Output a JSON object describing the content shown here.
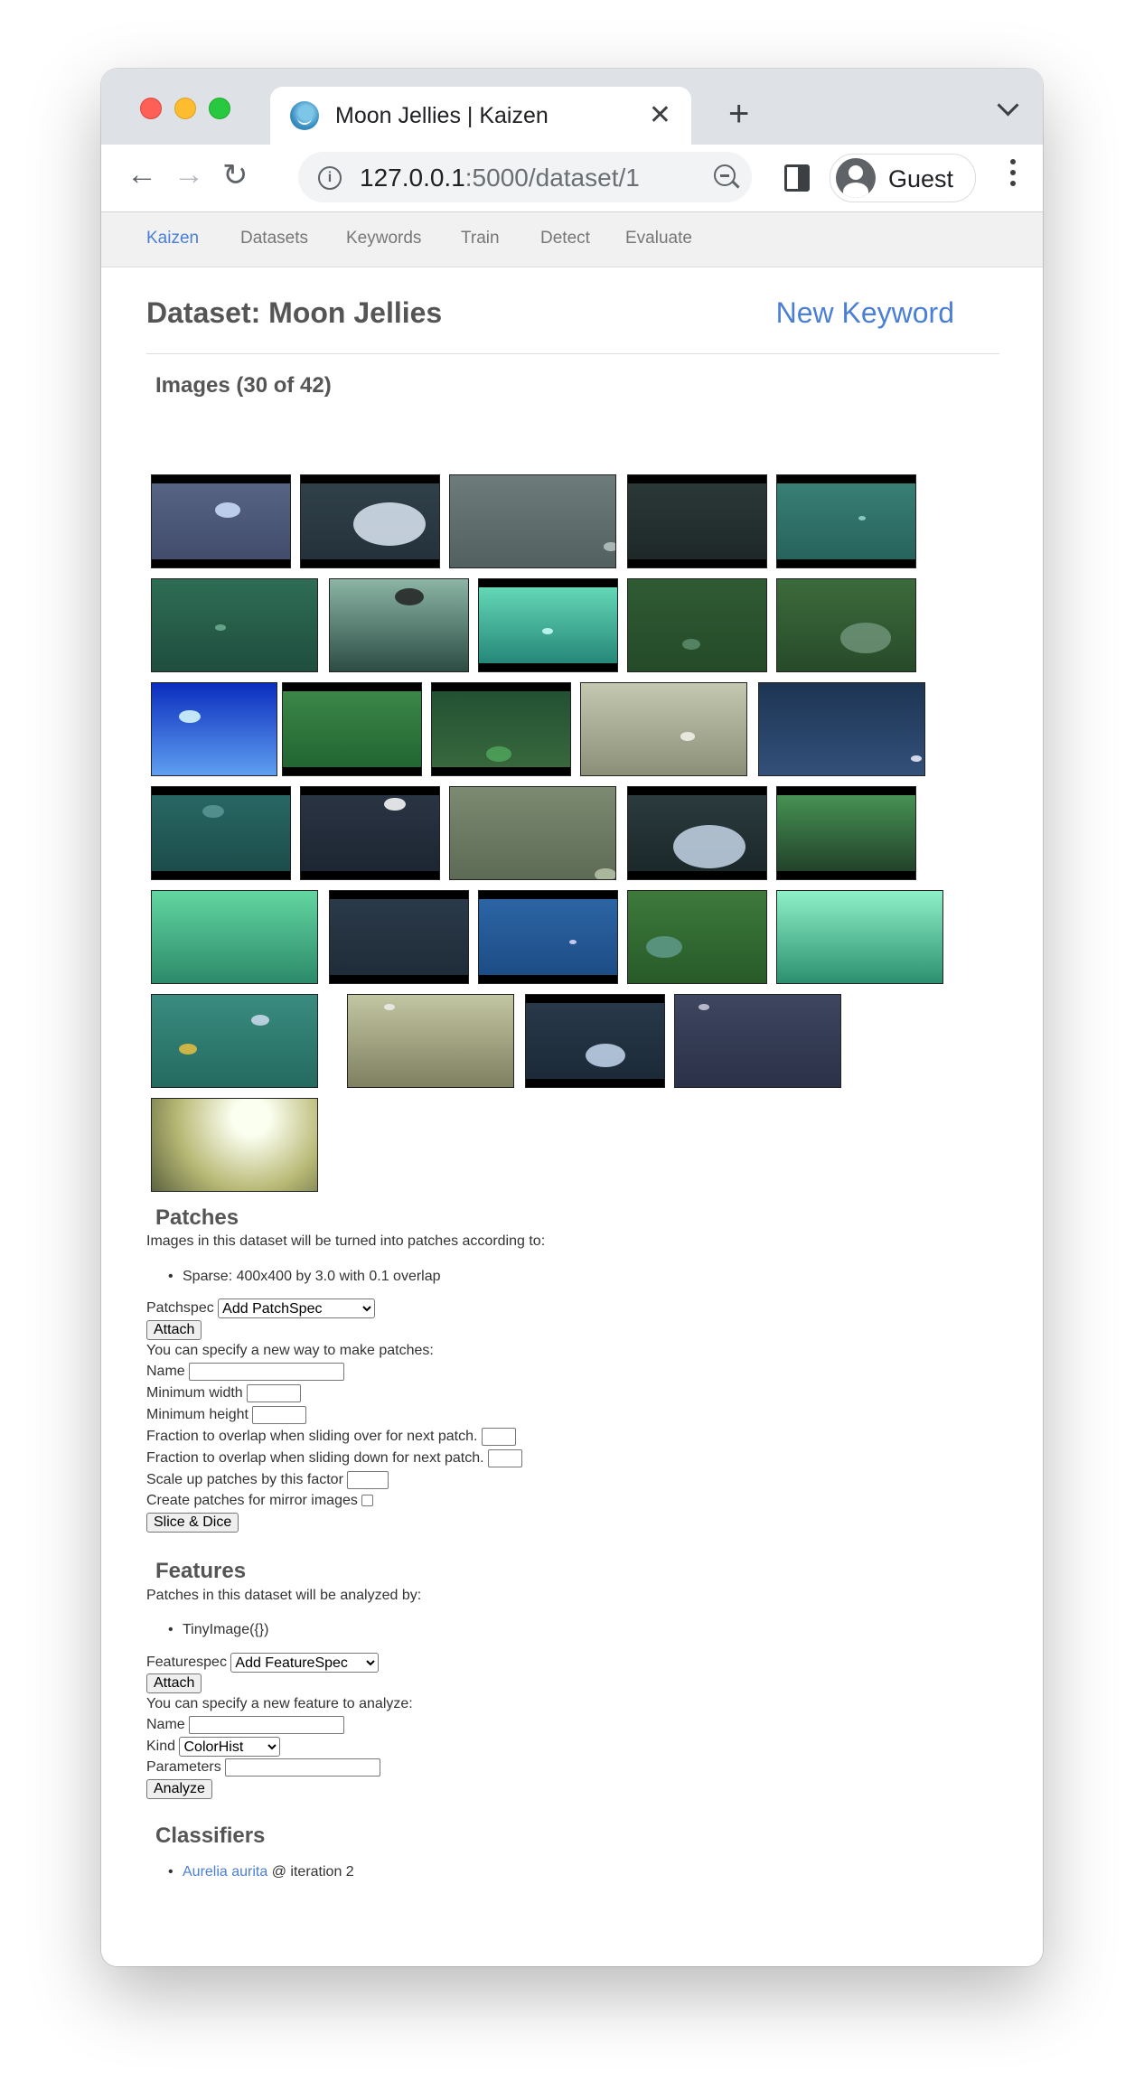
{
  "browser": {
    "tab_title": "Moon Jellies | Kaizen",
    "url_host": "127.0.0.1",
    "url_path": ":5000/dataset/1",
    "profile_name": "Guest"
  },
  "site_nav": {
    "brand": "Kaizen",
    "items": [
      "Datasets",
      "Keywords",
      "Train",
      "Detect",
      "Evaluate"
    ]
  },
  "header": {
    "title": "Dataset: Moon Jellies",
    "new_keyword": "New Keyword"
  },
  "images": {
    "heading": "Images (30 of 42)",
    "count_shown": 30
  },
  "patches": {
    "heading": "Patches",
    "intro": "Images in this dataset will be turned into patches according to:",
    "specs": [
      "Sparse: 400x400 by 3.0 with 0.1 overlap"
    ],
    "patchspec_label": "Patchspec",
    "patchspec_selected": "Add PatchSpec",
    "attach_label": "Attach",
    "new_intro": "You can specify a new way to make patches:",
    "name_label": "Name",
    "min_width_label": "Minimum width",
    "min_height_label": "Minimum height",
    "overlap_x_label": "Fraction to overlap when sliding over for next patch.",
    "overlap_y_label": "Fraction to overlap when sliding down for next patch.",
    "scale_label": "Scale up patches by this factor",
    "mirror_label": "Create patches for mirror images",
    "submit_label": "Slice & Dice"
  },
  "features": {
    "heading": "Features",
    "intro": "Patches in this dataset will be analyzed by:",
    "specs": [
      "TinyImage({})"
    ],
    "featurespec_label": "Featurespec",
    "featurespec_selected": "Add FeatureSpec",
    "attach_label": "Attach",
    "new_intro": "You can specify a new feature to analyze:",
    "name_label": "Name",
    "kind_label": "Kind",
    "kind_selected": "ColorHist",
    "parameters_label": "Parameters",
    "submit_label": "Analyze"
  },
  "classifiers": {
    "heading": "Classifiers",
    "items": [
      {
        "name": "Aurelia aurita",
        "suffix": "@ iteration 2"
      }
    ]
  },
  "colors": {
    "accent": "#4a7fd6",
    "heading": "#555555"
  }
}
